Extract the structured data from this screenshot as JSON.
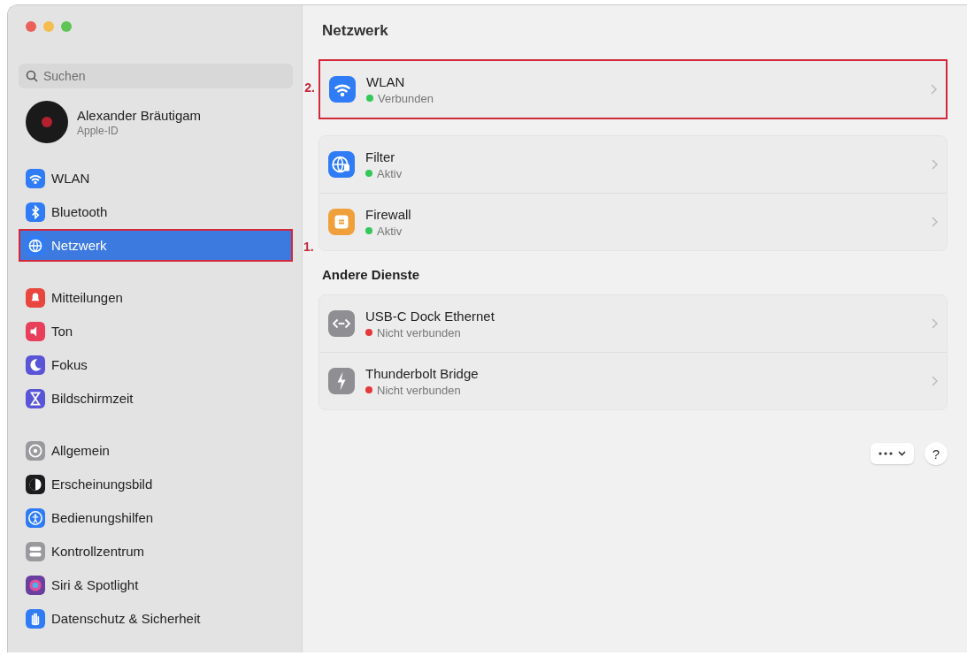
{
  "sidebar": {
    "search": {
      "placeholder": "Suchen"
    },
    "account": {
      "name": "Alexander Bräutigam",
      "subtitle": "Apple-ID"
    },
    "groups": [
      [
        {
          "label": "WLAN",
          "selected": false,
          "color": "#2f7cf6"
        },
        {
          "label": "Bluetooth",
          "selected": false,
          "color": "#2f7cf6"
        },
        {
          "label": "Netzwerk",
          "selected": true,
          "color": "#2f7cf6",
          "callout": "1."
        }
      ],
      [
        {
          "label": "Mitteilungen",
          "selected": false,
          "color": "#e8463e"
        },
        {
          "label": "Ton",
          "selected": false,
          "color": "#e8405a"
        },
        {
          "label": "Fokus",
          "selected": false,
          "color": "#5a55d6"
        },
        {
          "label": "Bildschirmzeit",
          "selected": false,
          "color": "#5a55d6"
        }
      ],
      [
        {
          "label": "Allgemein",
          "selected": false,
          "color": "#9a9a9e"
        },
        {
          "label": "Erscheinungsbild",
          "selected": false,
          "color": "#1c1c1e"
        },
        {
          "label": "Bedienungshilfen",
          "selected": false,
          "color": "#2f7cf6"
        },
        {
          "label": "Kontrollzentrum",
          "selected": false,
          "color": "#9a9a9e"
        },
        {
          "label": "Siri & Spotlight",
          "selected": false,
          "color": "#6b3fa0"
        },
        {
          "label": "Datenschutz & Sicherheit",
          "selected": false,
          "color": "#2f7cf6"
        }
      ]
    ]
  },
  "main": {
    "title": "Netzwerk",
    "sections": [
      {
        "services": [
          {
            "name": "WLAN",
            "status": "Verbunden",
            "color": "#34c759",
            "callout": "2."
          }
        ]
      },
      {
        "services": [
          {
            "name": "Filter",
            "status": "Aktiv",
            "color": "#34c759"
          },
          {
            "name": "Firewall",
            "status": "Aktiv",
            "color": "#34c759"
          }
        ]
      },
      {
        "heading": "Andere Dienste",
        "services": [
          {
            "name": "USB-C Dock Ethernet",
            "status": "Nicht verbunden",
            "color": "#e5383b"
          },
          {
            "name": "Thunderbolt Bridge",
            "status": "Nicht verbunden",
            "color": "#e5383b"
          }
        ]
      }
    ],
    "help": "?"
  }
}
